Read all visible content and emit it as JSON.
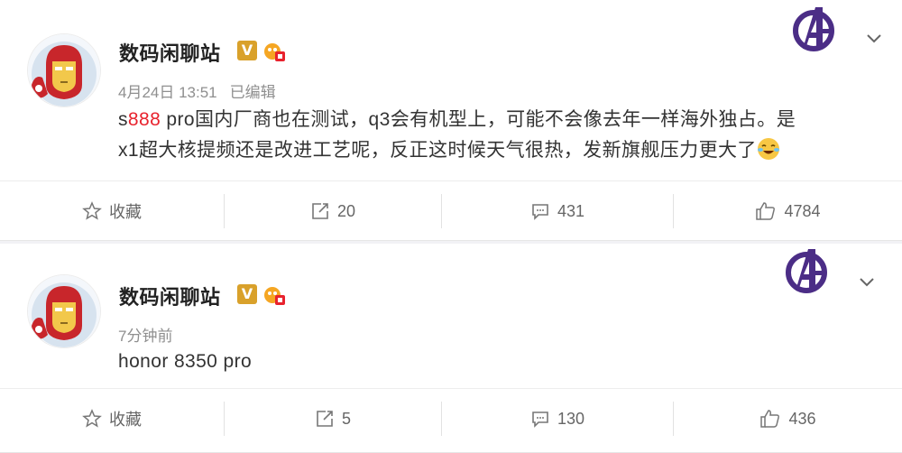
{
  "posts": [
    {
      "author": "数码闲聊站",
      "verified_badge": "V",
      "timestamp": "4月24日 13:51",
      "edited_label": "已编辑",
      "text_prefix": "s",
      "text_highlight": "888",
      "text_line1_rest": " pro国内厂商也在测试，q3会有机型上，可能不会像去年一样海外独占。是",
      "text_line2": "x1超大核提频还是改进工艺呢，反正这时候天气很热，发新旗舰压力更大了",
      "actions": {
        "favorite_label": "收藏",
        "repost_count": "20",
        "comment_count": "431",
        "like_count": "4784"
      }
    },
    {
      "author": "数码闲聊站",
      "verified_badge": "V",
      "timestamp": "7分钟前",
      "text": "honor 8350 pro",
      "actions": {
        "favorite_label": "收藏",
        "repost_count": "5",
        "comment_count": "130",
        "like_count": "436"
      }
    }
  ],
  "icons": {
    "avatar": "iron-man-avatar",
    "logo": "avengers-logo-icon",
    "menu": "chevron-down-icon",
    "favorite": "star-icon",
    "repost": "share-icon",
    "comment": "comment-icon",
    "like": "thumbs-up-icon",
    "emoji": "laughing-crying-emoji"
  },
  "colors": {
    "highlight": "#e8222d",
    "verified": "#d9a12b",
    "logo_purple": "#4b2d86"
  }
}
